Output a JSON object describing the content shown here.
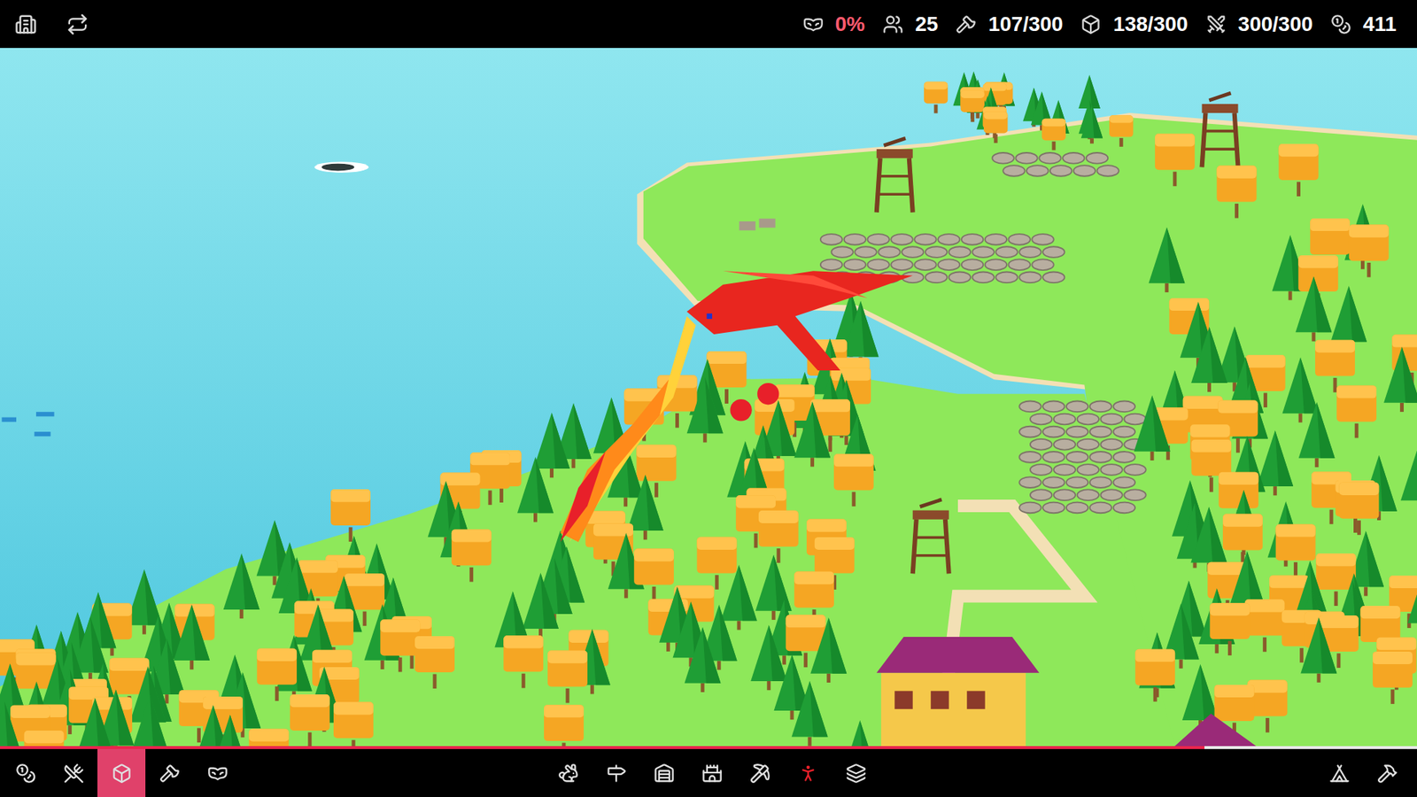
{
  "top_bar": {
    "resources": [
      {
        "value": "0%",
        "color": "#ff5a6e"
      },
      {
        "value": "25",
        "color": "#ffffff"
      },
      {
        "value": "107/300",
        "color": "#ffffff"
      },
      {
        "value": "138/300",
        "color": "#ffffff"
      },
      {
        "value": "300/300",
        "color": "#ffffff"
      },
      {
        "value": "411",
        "color": "#ffffff"
      }
    ]
  },
  "bottom_bar": {
    "progress": {
      "level": 0.85
    },
    "tabs": [
      {
        "selected": false
      },
      {
        "selected": false
      },
      {
        "selected": true
      },
      {
        "selected": false
      },
      {
        "selected": false
      }
    ],
    "build_tools": [
      {
        "highlighted": false
      },
      {
        "highlighted": false
      },
      {
        "highlighted": false
      },
      {
        "highlighted": false
      },
      {
        "highlighted": false
      },
      {
        "highlighted": true
      },
      {
        "highlighted": false
      }
    ]
  }
}
